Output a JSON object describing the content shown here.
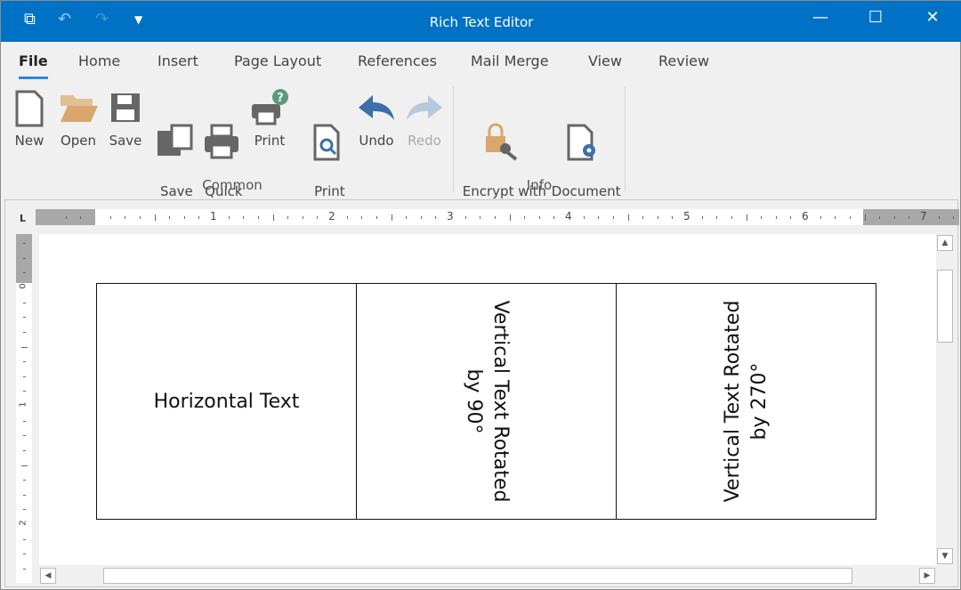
{
  "window": {
    "title": "Rich Text Editor"
  },
  "quick_access": [
    "app-icon",
    "undo-icon",
    "redo-icon",
    "customize-icon"
  ],
  "tabs": [
    {
      "label": "File",
      "active": true
    },
    {
      "label": "Home"
    },
    {
      "label": "Insert"
    },
    {
      "label": "Page Layout"
    },
    {
      "label": "References"
    },
    {
      "label": "Mail Merge"
    },
    {
      "label": "View"
    },
    {
      "label": "Review"
    }
  ],
  "ribbon": {
    "buttons": {
      "new": "New",
      "open": "Open",
      "save": "Save",
      "save_as": "Save\nAs",
      "quick_print": "Quick\nPrint",
      "print": "Print",
      "print_preview": "Print\nPreview",
      "undo": "Undo",
      "redo": "Redo",
      "encrypt": "Encrypt with\nPassword",
      "doc_props": "Document\nProperties"
    },
    "groups": {
      "common": "Common",
      "info": "Info"
    }
  },
  "ruler": {
    "h_labels": [
      "1",
      "2",
      "3",
      "4",
      "5",
      "6",
      "7"
    ],
    "v_labels": [
      "0",
      "1",
      "2"
    ]
  },
  "document": {
    "cells": [
      "Horizontal Text",
      "Vertical Text Rotated\nby 90°",
      "Vertical Text Rotated\nby 270°"
    ]
  },
  "colors": {
    "titlebar": "#0072c6",
    "accent": "#2b88d8",
    "undo": "#3e6fa8",
    "open": "#d9a66b"
  }
}
